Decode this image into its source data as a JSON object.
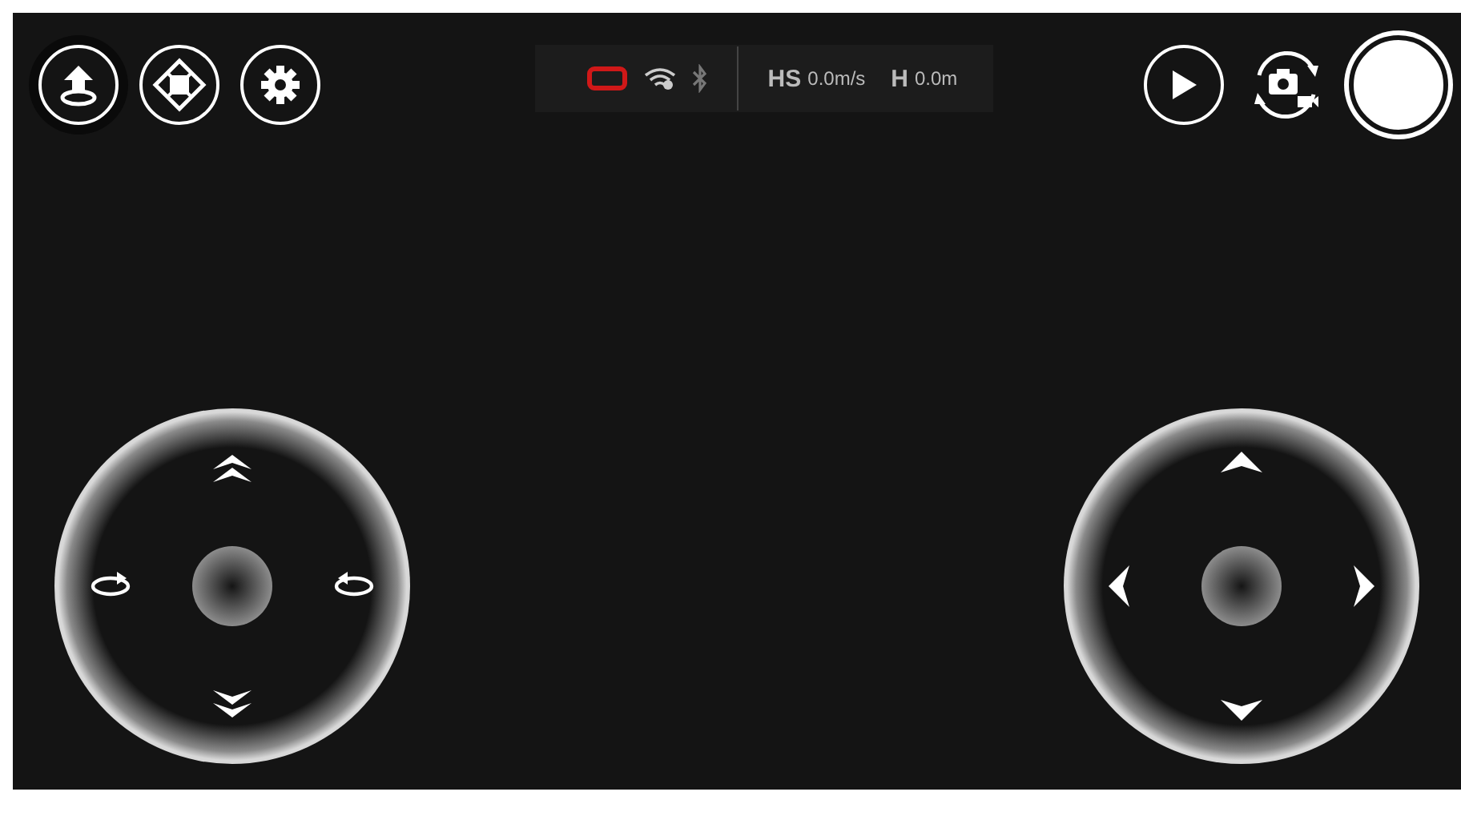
{
  "telemetry": {
    "speed_label": "HS",
    "speed": "0.0m/s",
    "height_label": "H",
    "height": "0.0m"
  },
  "joysticks": [
    {
      "kind": "throttle"
    },
    {
      "kind": "direction"
    }
  ]
}
